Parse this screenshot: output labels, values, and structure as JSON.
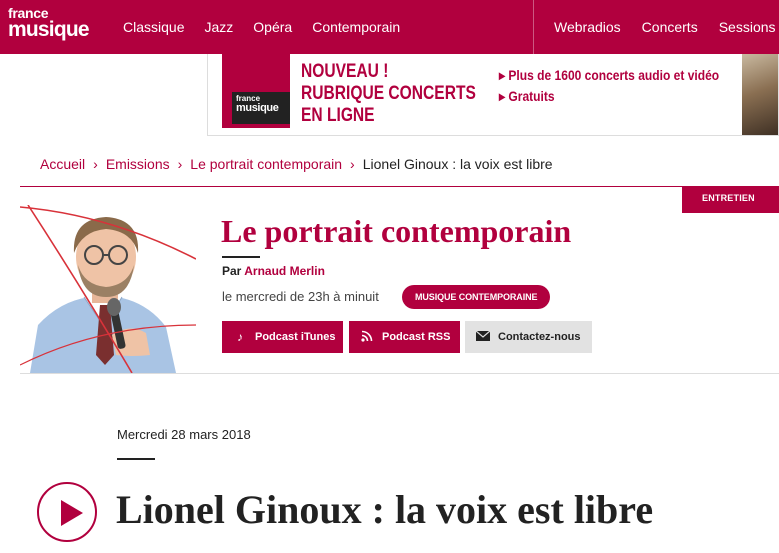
{
  "header": {
    "logo_line1": "france",
    "logo_line2": "musique",
    "nav_left": [
      "Classique",
      "Jazz",
      "Opéra",
      "Contemporain"
    ],
    "nav_right": [
      "Webradios",
      "Concerts",
      "Sessions"
    ]
  },
  "banner": {
    "logo_line1": "france",
    "logo_line2": "musique",
    "headline_1": "NOUVEAU !",
    "headline_2": "RUBRIQUE CONCERTS",
    "headline_3": "EN LIGNE",
    "bullet_1": "▸ Plus de 1600 concerts audio et vidéo",
    "bullet_2": "▸ Gratuits"
  },
  "breadcrumb": {
    "items": [
      "Accueil",
      "Emissions",
      "Le portrait contemporain"
    ],
    "current": "Lionel Ginoux : la voix est libre",
    "separator": "›"
  },
  "show": {
    "tag": "ENTRETIEN",
    "title": "Le portrait contemporain",
    "by_prefix": "Par",
    "author": "Arnaud Merlin",
    "schedule": "le mercredi de 23h à minuit",
    "genre_pill": "MUSIQUE CONTEMPORAINE",
    "btn_itunes": "Podcast iTunes",
    "btn_rss": "Podcast RSS",
    "btn_contact": "Contactez-nous"
  },
  "episode": {
    "date": "Mercredi 28 mars 2018",
    "title": "Lionel Ginoux : la voix est libre"
  },
  "colors": {
    "brand": "#b1003e",
    "contact_bg": "#e2e2e2"
  },
  "icons": {
    "itunes": "music-note-icon",
    "rss": "rss-icon",
    "contact": "envelope-icon",
    "play": "play-icon"
  }
}
